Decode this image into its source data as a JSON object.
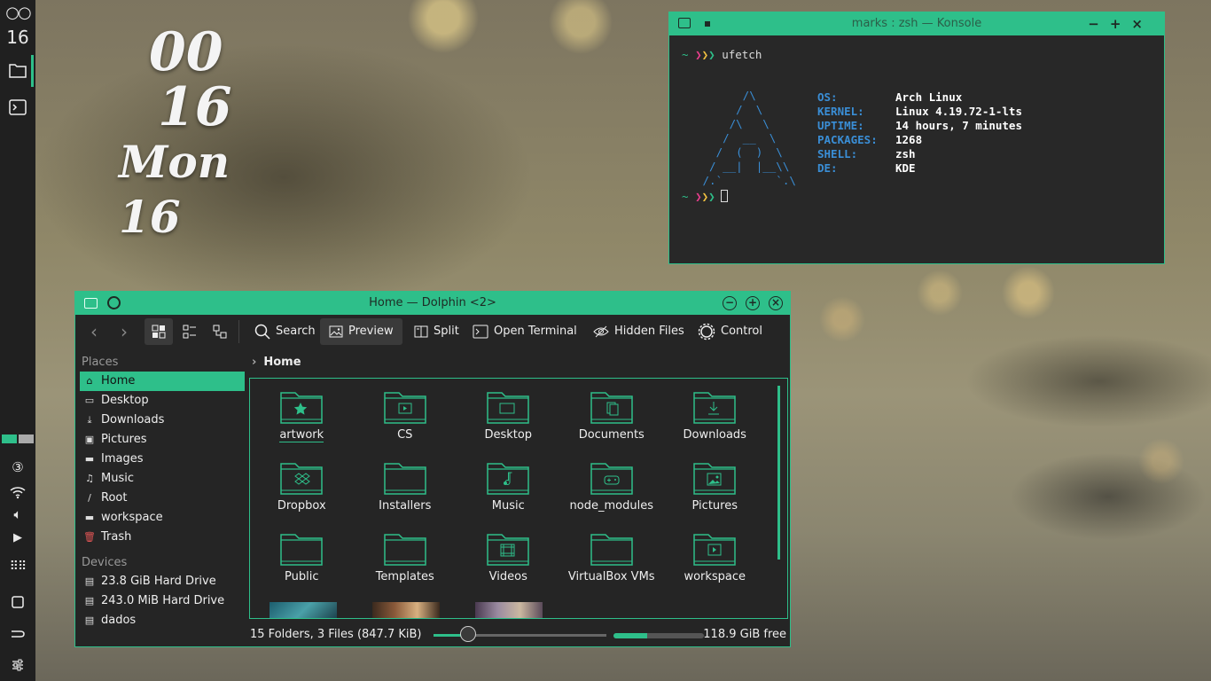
{
  "dock": {
    "clock_num": "16"
  },
  "clock": {
    "hour": "00",
    "minute": "16",
    "day": "Mon 16"
  },
  "konsole": {
    "title": "marks : zsh — Konsole",
    "command": "ufetch",
    "info": [
      {
        "key": "OS:",
        "value": "Arch Linux"
      },
      {
        "key": "KERNEL:",
        "value": "Linux 4.19.72-1-lts"
      },
      {
        "key": "UPTIME:",
        "value": "14 hours, 7 minutes"
      },
      {
        "key": "PACKAGES:",
        "value": "1268"
      },
      {
        "key": "SHELL:",
        "value": "zsh"
      },
      {
        "key": "DE:",
        "value": "KDE"
      }
    ]
  },
  "dolphin": {
    "title": "Home — Dolphin <2>",
    "toolbar": {
      "search": "Search",
      "preview": "Preview",
      "split": "Split",
      "open_terminal": "Open Terminal",
      "hidden_files": "Hidden Files",
      "control": "Control"
    },
    "places_header": "Places",
    "places": [
      "Home",
      "Desktop",
      "Downloads",
      "Pictures",
      "Images",
      "Music",
      "Root",
      "workspace",
      "Trash"
    ],
    "devices_header": "Devices",
    "devices": [
      "23.8 GiB Hard Drive",
      "243.0 MiB Hard Drive",
      "dados"
    ],
    "breadcrumb": "Home",
    "folders": [
      "artwork",
      "CS",
      "Desktop",
      "Documents",
      "Downloads",
      "Dropbox",
      "Installers",
      "Music",
      "node_modules",
      "Pictures",
      "Public",
      "Templates",
      "Videos",
      "VirtualBox VMs",
      "workspace"
    ],
    "status": {
      "summary": "15 Folders, 3 Files (847.7 KiB)",
      "free": "118.9 GiB free",
      "disk_used_fraction": 0.37
    },
    "accent": "#2ebf8a"
  }
}
